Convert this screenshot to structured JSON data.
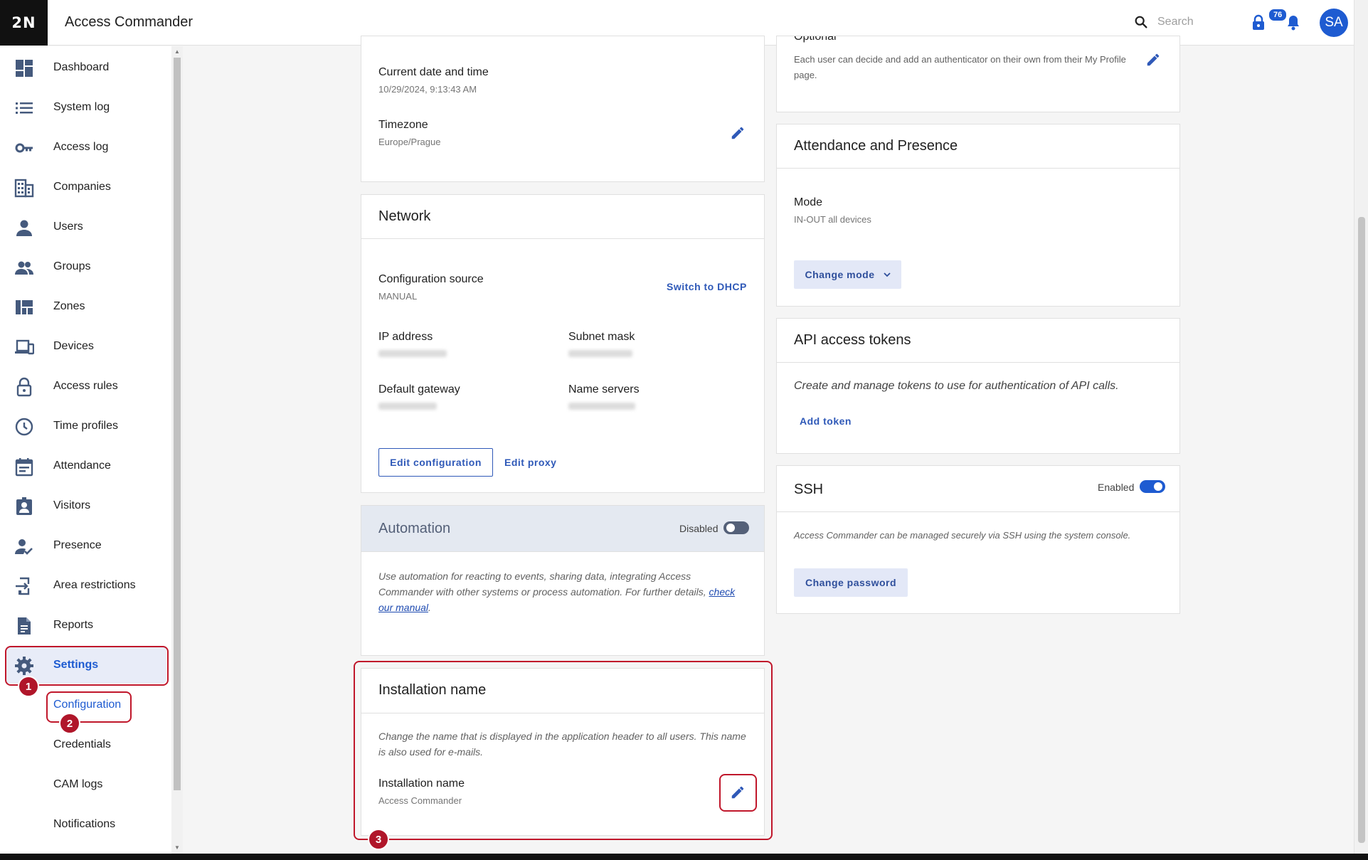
{
  "header": {
    "logo": "2N",
    "app_title": "Access Commander",
    "search_placeholder": "Search",
    "notifications_count": "76",
    "avatar_initials": "SA"
  },
  "sidebar": {
    "items": [
      {
        "label": "Dashboard",
        "icon": "dashboard-icon"
      },
      {
        "label": "System log",
        "icon": "list-icon"
      },
      {
        "label": "Access log",
        "icon": "key-icon"
      },
      {
        "label": "Companies",
        "icon": "building-icon"
      },
      {
        "label": "Users",
        "icon": "person-icon"
      },
      {
        "label": "Groups",
        "icon": "group-icon"
      },
      {
        "label": "Zones",
        "icon": "zones-icon"
      },
      {
        "label": "Devices",
        "icon": "devices-icon"
      },
      {
        "label": "Access rules",
        "icon": "lock-icon"
      },
      {
        "label": "Time profiles",
        "icon": "clock-icon"
      },
      {
        "label": "Attendance",
        "icon": "calendar-icon"
      },
      {
        "label": "Visitors",
        "icon": "visitor-badge-icon"
      },
      {
        "label": "Presence",
        "icon": "person-check-icon"
      },
      {
        "label": "Area restrictions",
        "icon": "area-restriction-icon"
      },
      {
        "label": "Reports",
        "icon": "report-icon"
      },
      {
        "label": "Settings",
        "icon": "gear-icon"
      }
    ],
    "sub_items": [
      "Configuration",
      "Credentials",
      "CAM logs",
      "Notifications"
    ]
  },
  "datetime_card": {
    "current_label": "Current date and time",
    "current_value": "10/29/2024, 9:13:43 AM",
    "timezone_label": "Timezone",
    "timezone_value": "Europe/Prague"
  },
  "network_card": {
    "title": "Network",
    "config_source_label": "Configuration source",
    "config_source_value": "MANUAL",
    "switch_dhcp": "Switch to DHCP",
    "ip_label": "IP address",
    "subnet_label": "Subnet mask",
    "gateway_label": "Default gateway",
    "dns_label": "Name servers",
    "edit_config": "Edit configuration",
    "edit_proxy": "Edit proxy"
  },
  "automation_card": {
    "title": "Automation",
    "toggle_label": "Disabled",
    "enabled": false,
    "description": "Use automation for reacting to events, sharing data, integrating Access Commander with other systems or process automation. For further details,",
    "link_text": "check our manual",
    "trailing": "."
  },
  "installation_card": {
    "title": "Installation name",
    "description": "Change the name that is displayed in the application header to all users. This name is also used for e-mails.",
    "field_label": "Installation name",
    "field_value": "Access Commander"
  },
  "twofa_card": {
    "partial_label": "Optional",
    "description": "Each user can decide and add an authenticator on their own from their My Profile page."
  },
  "attendance_card": {
    "title": "Attendance and Presence",
    "mode_label": "Mode",
    "mode_value": "IN-OUT all devices",
    "change_mode": "Change mode"
  },
  "api_card": {
    "title": "API access tokens",
    "description": "Create and manage tokens to use for authentication of API calls.",
    "add_token": "Add token"
  },
  "ssh_card": {
    "title": "SSH",
    "toggle_label": "Enabled",
    "enabled": true,
    "description": "Access Commander can be managed securely via SSH using the system console.",
    "change_password": "Change password"
  },
  "annotations": {
    "markers": [
      "1",
      "2",
      "3"
    ]
  },
  "colors": {
    "accent": "#1e5bd1",
    "highlight": "#c0172b"
  }
}
